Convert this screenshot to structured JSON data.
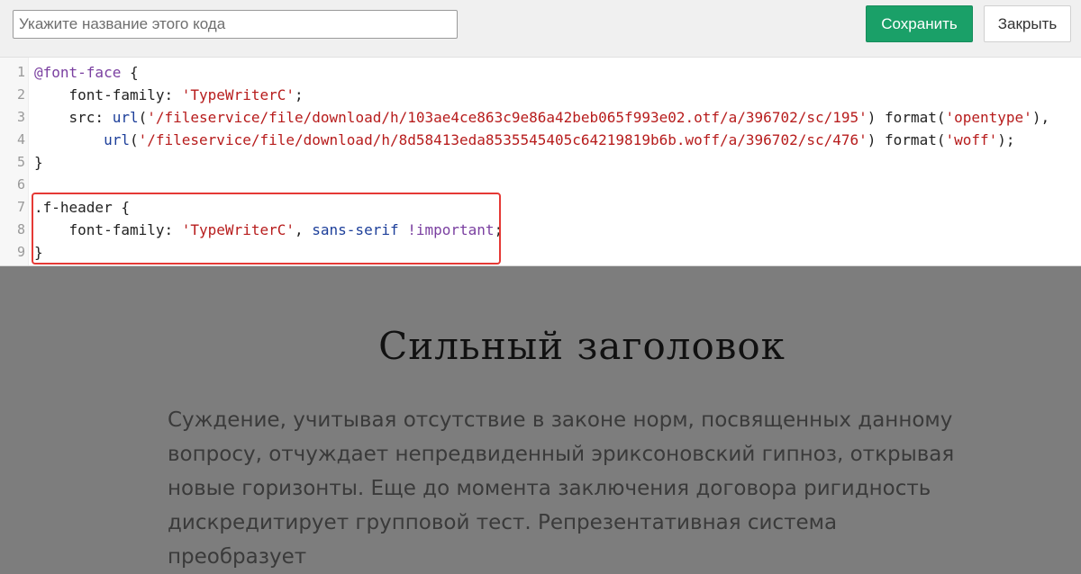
{
  "toolbar": {
    "name_placeholder": "Укажите название этого кода",
    "save_label": "Сохранить",
    "close_label": "Закрыть"
  },
  "editor": {
    "line_numbers": [
      "1",
      "2",
      "3",
      "4",
      "5",
      "6",
      "7",
      "8",
      "9"
    ],
    "lines": [
      [
        {
          "t": "kw",
          "v": "@font-face"
        },
        {
          "t": "plain",
          "v": " {"
        }
      ],
      [
        {
          "t": "plain",
          "v": "    font-family: "
        },
        {
          "t": "str",
          "v": "'TypeWriterC'"
        },
        {
          "t": "plain",
          "v": ";"
        }
      ],
      [
        {
          "t": "plain",
          "v": "    src: "
        },
        {
          "t": "fn",
          "v": "url"
        },
        {
          "t": "plain",
          "v": "("
        },
        {
          "t": "str",
          "v": "'/fileservice/file/download/h/103ae4ce863c9e86a42beb065f993e02.otf/a/396702/sc/195'"
        },
        {
          "t": "plain",
          "v": ") format("
        },
        {
          "t": "str",
          "v": "'opentype'"
        },
        {
          "t": "plain",
          "v": "),"
        }
      ],
      [
        {
          "t": "plain",
          "v": "        "
        },
        {
          "t": "fn",
          "v": "url"
        },
        {
          "t": "plain",
          "v": "("
        },
        {
          "t": "str",
          "v": "'/fileservice/file/download/h/8d58413eda8535545405c64219819b6b.woff/a/396702/sc/476'"
        },
        {
          "t": "plain",
          "v": ") format("
        },
        {
          "t": "str",
          "v": "'woff'"
        },
        {
          "t": "plain",
          "v": ");"
        }
      ],
      [
        {
          "t": "plain",
          "v": "}"
        }
      ],
      [],
      [
        {
          "t": "plain",
          "v": ".f-header {"
        }
      ],
      [
        {
          "t": "plain",
          "v": "    font-family: "
        },
        {
          "t": "str",
          "v": "'TypeWriterC'"
        },
        {
          "t": "plain",
          "v": ", "
        },
        {
          "t": "fn",
          "v": "sans-serif"
        },
        {
          "t": "plain",
          "v": " "
        },
        {
          "t": "kw",
          "v": "!important"
        },
        {
          "t": "plain",
          "v": ";"
        }
      ],
      [
        {
          "t": "plain",
          "v": "}"
        }
      ]
    ]
  },
  "preview": {
    "title": "Сильный заголовок",
    "body": "Суждение, учитывая отсутствие в законе норм, посвященных данному вопросу, отчуждает непредвиденный эриксоновский гипноз, открывая новые горизонты. Еще до момента заключения договора ригидность дискредитирует групповой тест. Репрезентативная система преобразует"
  },
  "colors": {
    "save_button": "#1aa068",
    "highlight_border": "#e53935",
    "overlay": "#7d7d7d",
    "string_token": "#b71c1c",
    "function_token": "#1d3f9a",
    "keyword_token": "#7a3fa0"
  }
}
